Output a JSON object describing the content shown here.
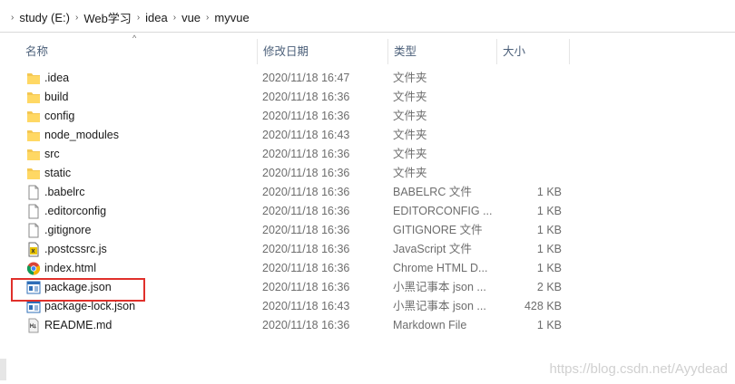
{
  "breadcrumb": [
    "study (E:)",
    "Web学习",
    "idea",
    "vue",
    "myvue"
  ],
  "columns": {
    "name": "名称",
    "date": "修改日期",
    "type": "类型",
    "size": "大小"
  },
  "files": [
    {
      "name": ".idea",
      "date": "2020/11/18 16:47",
      "type": "文件夹",
      "size": "",
      "icon": "folder-icon"
    },
    {
      "name": "build",
      "date": "2020/11/18 16:36",
      "type": "文件夹",
      "size": "",
      "icon": "folder-icon"
    },
    {
      "name": "config",
      "date": "2020/11/18 16:36",
      "type": "文件夹",
      "size": "",
      "icon": "folder-icon"
    },
    {
      "name": "node_modules",
      "date": "2020/11/18 16:43",
      "type": "文件夹",
      "size": "",
      "icon": "folder-icon"
    },
    {
      "name": "src",
      "date": "2020/11/18 16:36",
      "type": "文件夹",
      "size": "",
      "icon": "folder-icon"
    },
    {
      "name": "static",
      "date": "2020/11/18 16:36",
      "type": "文件夹",
      "size": "",
      "icon": "folder-icon"
    },
    {
      "name": ".babelrc",
      "date": "2020/11/18 16:36",
      "type": "BABELRC 文件",
      "size": "1 KB",
      "icon": "file-icon"
    },
    {
      "name": ".editorconfig",
      "date": "2020/11/18 16:36",
      "type": "EDITORCONFIG ...",
      "size": "1 KB",
      "icon": "file-icon"
    },
    {
      "name": ".gitignore",
      "date": "2020/11/18 16:36",
      "type": "GITIGNORE 文件",
      "size": "1 KB",
      "icon": "file-icon"
    },
    {
      "name": ".postcssrc.js",
      "date": "2020/11/18 16:36",
      "type": "JavaScript 文件",
      "size": "1 KB",
      "icon": "js-file-icon"
    },
    {
      "name": "index.html",
      "date": "2020/11/18 16:36",
      "type": "Chrome HTML D...",
      "size": "1 KB",
      "icon": "chrome-html-icon"
    },
    {
      "name": "package.json",
      "date": "2020/11/18 16:36",
      "type": "小黑记事本 json ...",
      "size": "2 KB",
      "icon": "json-file-icon"
    },
    {
      "name": "package-lock.json",
      "date": "2020/11/18 16:43",
      "type": "小黑记事本 json ...",
      "size": "428 KB",
      "icon": "json-file-icon"
    },
    {
      "name": "README.md",
      "date": "2020/11/18 16:36",
      "type": "Markdown File",
      "size": "1 KB",
      "icon": "markdown-file-icon"
    }
  ],
  "watermark": "https://blog.csdn.net/Ayydead"
}
